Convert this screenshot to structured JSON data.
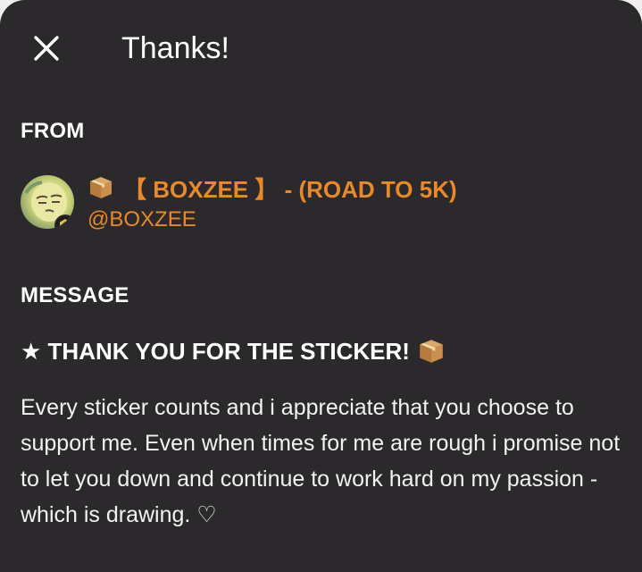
{
  "header": {
    "close_icon": "close-icon",
    "title": "Thanks!"
  },
  "from": {
    "label": "FROM",
    "sender": {
      "avatar_icon": "avatar",
      "emoji_icon": "package-box-icon",
      "display_name": "【 BOXZEE 】 - (ROAD TO 5K)",
      "handle": "@BOXZEE"
    }
  },
  "message": {
    "label": "MESSAGE",
    "title": "★ THANK YOU FOR THE STICKER!",
    "title_emoji_icon": "package-box-icon",
    "body": "Every sticker counts and i appreciate that you choose to support me. Even when times for me are rough i promise not to let you down and continue to work hard on my passion - which is drawing. ♡"
  },
  "colors": {
    "background": "#2b292b",
    "accent": "#e8892b",
    "text": "#ffffff"
  }
}
